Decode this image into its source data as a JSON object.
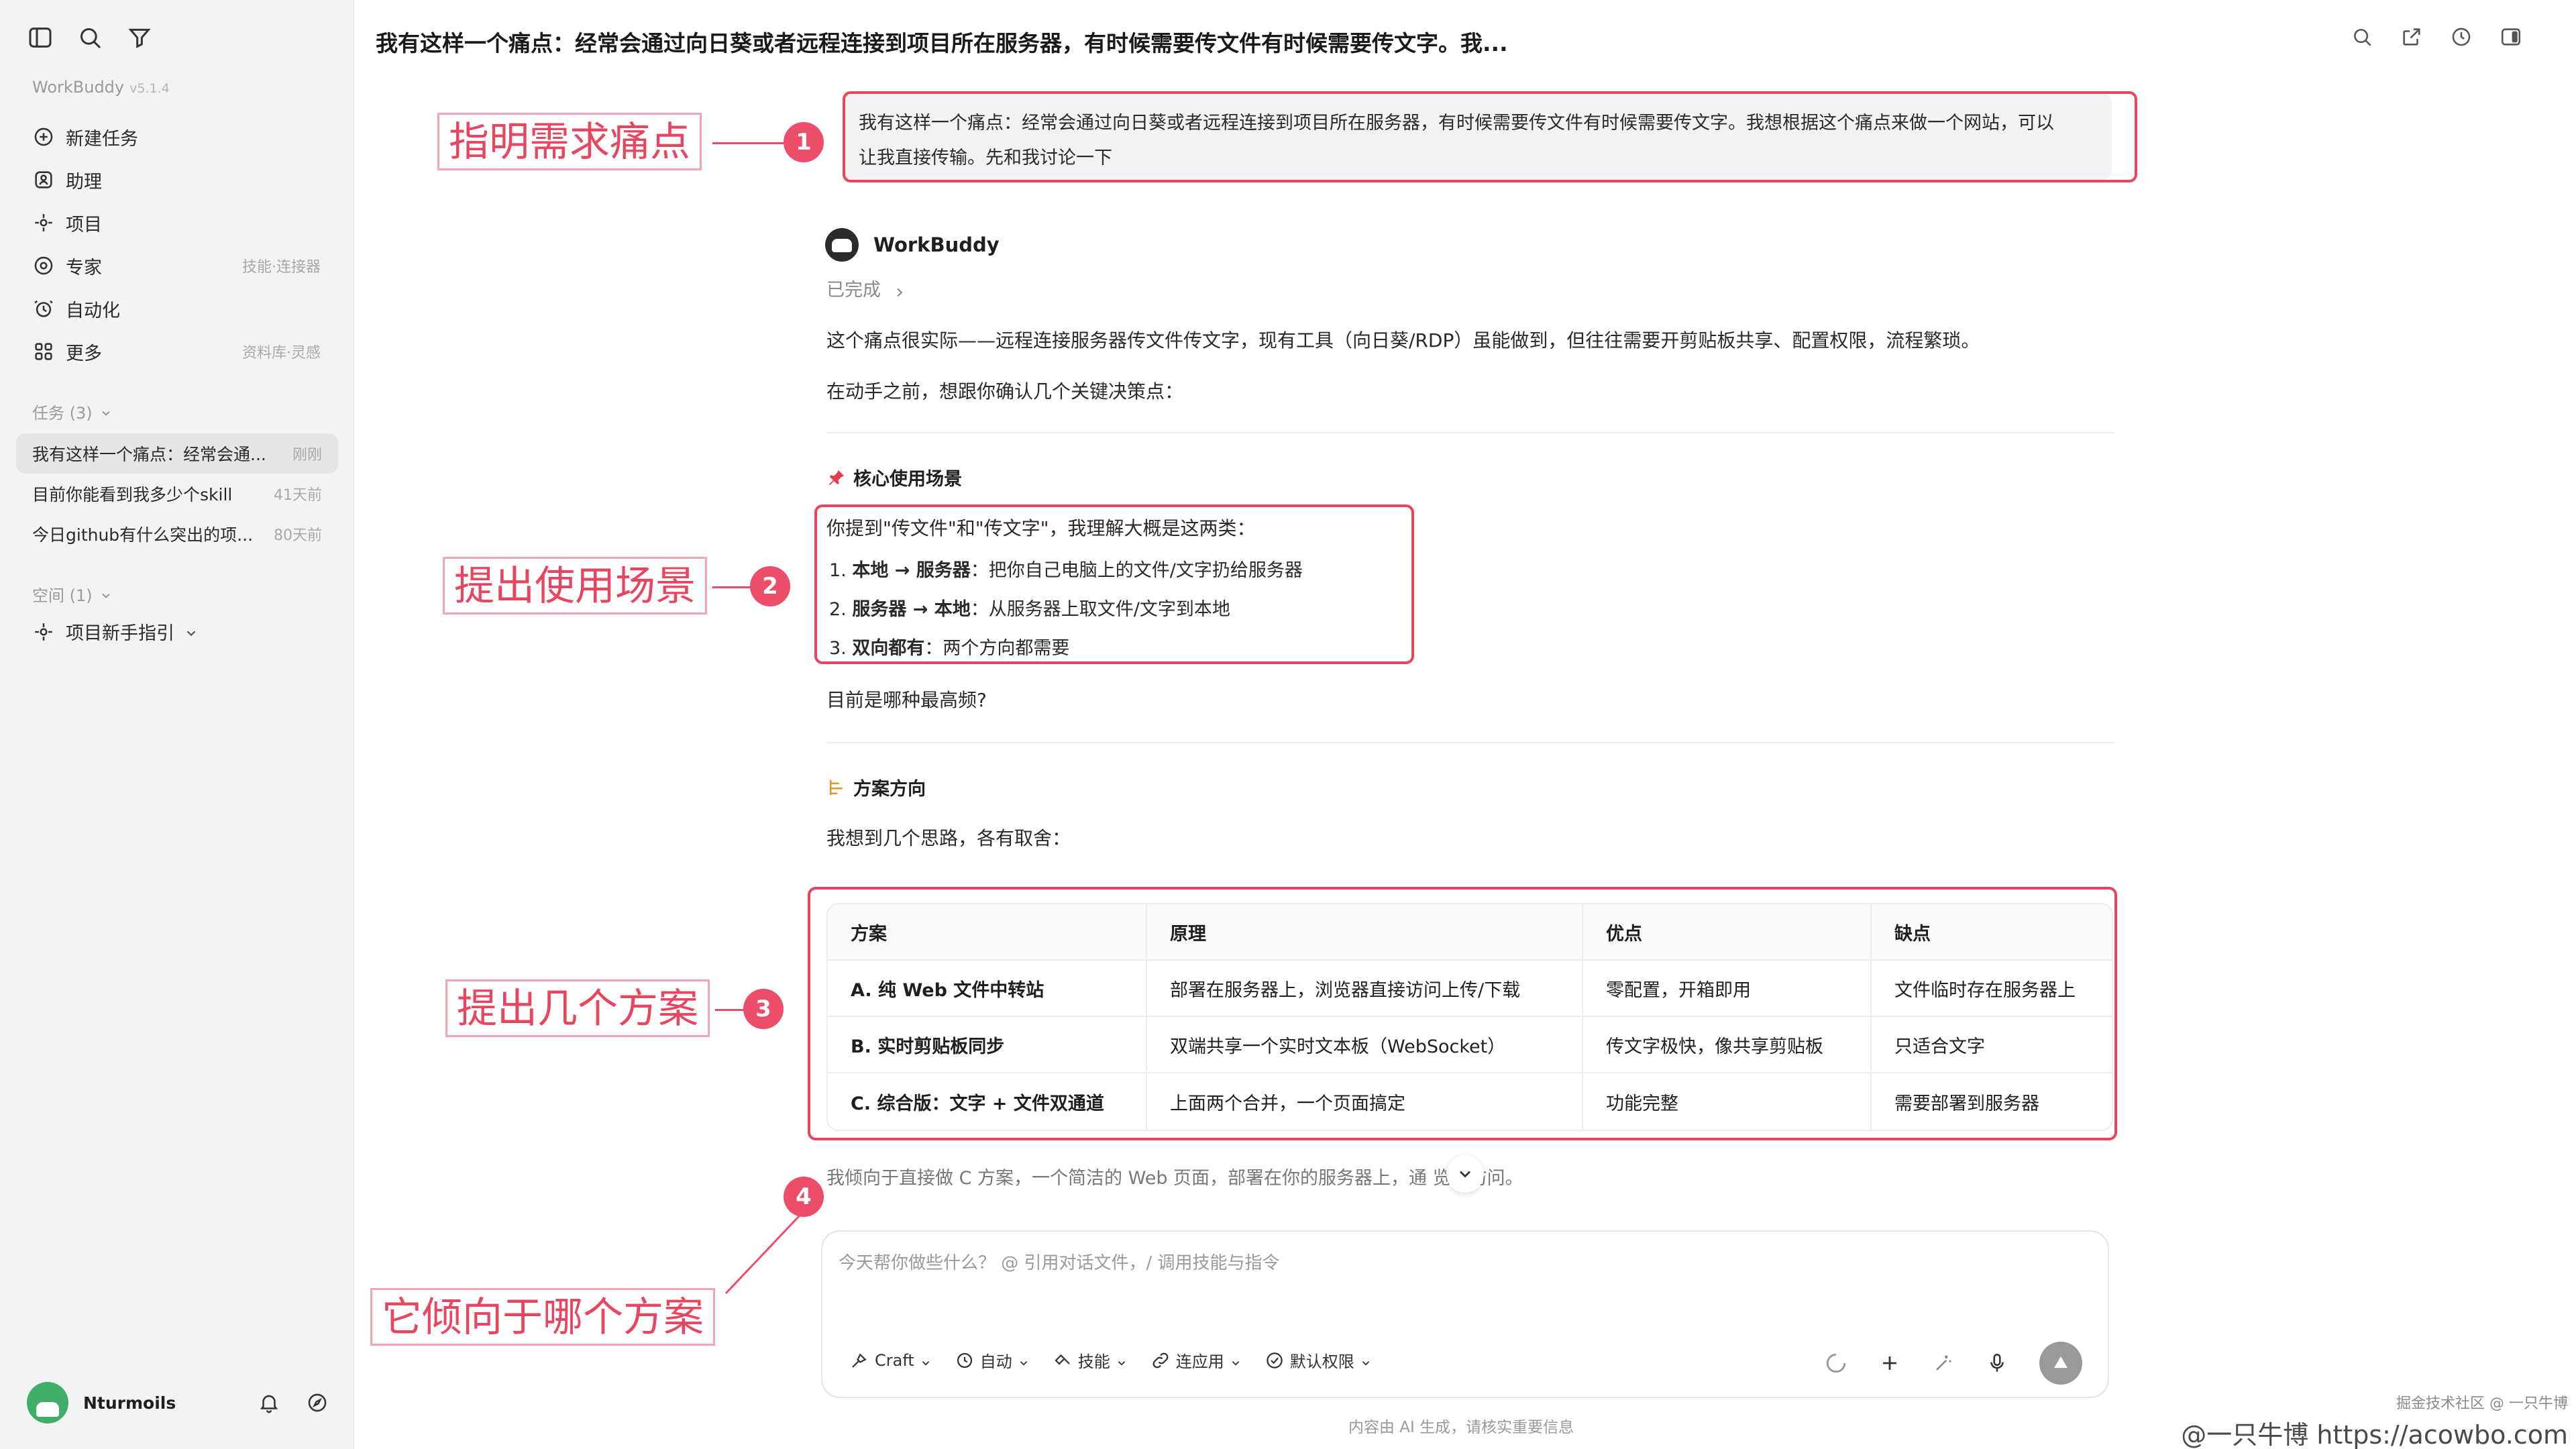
{
  "app": {
    "name": "WorkBuddy",
    "version": "v5.1.4"
  },
  "sidebar": {
    "nav": [
      {
        "label": "新建任务",
        "hint": "",
        "icon": "plus-circle-icon"
      },
      {
        "label": "助理",
        "hint": "",
        "icon": "assistant-icon"
      },
      {
        "label": "项目",
        "hint": "",
        "icon": "project-icon"
      },
      {
        "label": "专家",
        "hint": "技能·连接器",
        "icon": "expert-icon"
      },
      {
        "label": "自动化",
        "hint": "",
        "icon": "alarm-icon"
      },
      {
        "label": "更多",
        "hint": "资料库·灵感",
        "icon": "grid-icon"
      }
    ],
    "tasks_label": "任务 (3)",
    "tasks": [
      {
        "title": "我有这样一个痛点：经常会通...",
        "time": "刚刚"
      },
      {
        "title": "目前你能看到我多少个skill",
        "time": "41天前"
      },
      {
        "title": "今日github有什么突出的项...",
        "time": "80天前"
      }
    ],
    "space_label": "空间 (1)",
    "space_item": "项目新手指引",
    "user_name": "Nturmoils"
  },
  "conversation": {
    "title": "我有这样一个痛点：经常会通过向日葵或者远程连接到项目所在服务器，有时候需要传文件有时候需要传文字。我...",
    "user_line1": "我有这样一个痛点：经常会通过向日葵或者远程连接到项目所在服务器，有时候需要传文件有时候需要传文字。我想根据这个痛点来做一个网站，可以",
    "user_line2": "让我直接传输。先和我讨论一下",
    "bot_name": "WorkBuddy",
    "status": "已完成",
    "p1": "这个痛点很实际——远程连接服务器传文件传文字，现有工具（向日葵/RDP）虽能做到，但往往需要开剪贴板共享、配置权限，流程繁琐。",
    "p2": "在动手之前，想跟你确认几个关键决策点：",
    "section1_title": "核心使用场景",
    "s1_intro": "你提到\"传文件\"和\"传文字\"，我理解大概是这两类：",
    "s1_items": [
      {
        "num": "1.",
        "bold": "本地 → 服务器",
        "rest": "：把你自己电脑上的文件/文字扔给服务器"
      },
      {
        "num": "2.",
        "bold": "服务器 → 本地",
        "rest": "：从服务器上取文件/文字到本地"
      },
      {
        "num": "3.",
        "bold": "双向都有",
        "rest": "：两个方向都需要"
      }
    ],
    "s1_question": "目前是哪种最高频?",
    "section2_title": "方案方向",
    "s2_intro": "我想到几个思路，各有取舍：",
    "table": {
      "headers": [
        "方案",
        "原理",
        "优点",
        "缺点"
      ],
      "rows": [
        [
          "A. 纯 Web 文件中转站",
          "部署在服务器上，浏览器直接访问上传/下载",
          "零配置，开箱即用",
          "文件临时存在服务器上"
        ],
        [
          "B. 实时剪贴板同步",
          "双端共享一个实时文本板（WebSocket）",
          "传文字极快，像共享剪贴板",
          "只适合文字"
        ],
        [
          "C. 综合版：文字 + 文件双通道",
          "上面两个合并，一个页面搞定",
          "功能完整",
          "需要部署到服务器"
        ]
      ]
    },
    "partial_line": "我倾向于直接做 C 方案，一个简洁的 Web 页面，部署在你的服务器上，通    览器访问。"
  },
  "composer": {
    "placeholder": "今天帮你做些什么？ @ 引用对话文件，/ 调用技能与指令",
    "tools": [
      {
        "label": "Craft",
        "icon": "craft-icon"
      },
      {
        "label": "自动",
        "icon": "auto-icon"
      },
      {
        "label": "技能",
        "icon": "skill-icon"
      },
      {
        "label": "连应用",
        "icon": "link-icon"
      },
      {
        "label": "默认权限",
        "icon": "check-shield-icon"
      }
    ],
    "footer": "内容由 AI 生成，请核实重要信息"
  },
  "annotations": [
    {
      "num": "1",
      "label": "指明需求痛点"
    },
    {
      "num": "2",
      "label": "提出使用场景"
    },
    {
      "num": "3",
      "label": "提出几个方案"
    },
    {
      "num": "4",
      "label": "它倾向于哪个方案"
    }
  ],
  "watermark": {
    "line1": "掘金技术社区 @ 一只牛博",
    "line2": "@一只牛博 https://acowbo.com"
  },
  "colors": {
    "annotation": "#e8455f",
    "sidebar_bg": "#f3f3f3"
  }
}
